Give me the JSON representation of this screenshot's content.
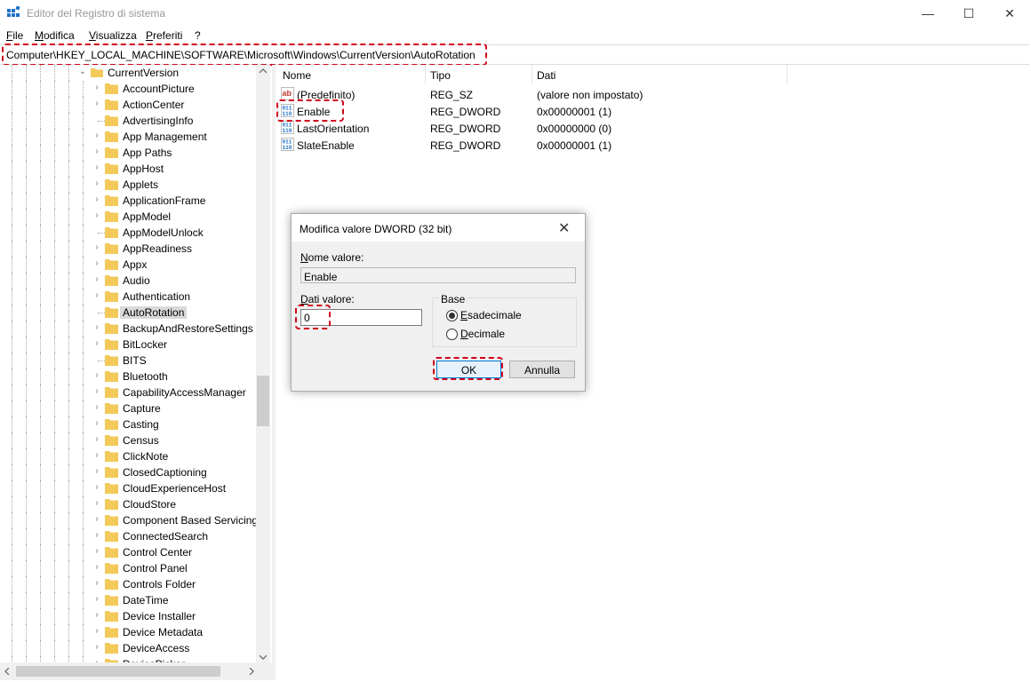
{
  "window": {
    "title": "Editor del Registro di sistema",
    "minimize_glyph": "—",
    "maximize_glyph": "☐",
    "close_glyph": "✕"
  },
  "menu": [
    "File",
    "Modifica",
    "Visualizza",
    "Preferiti",
    "?"
  ],
  "address": "Computer\\HKEY_LOCAL_MACHINE\\SOFTWARE\\Microsoft\\Windows\\CurrentVersion\\AutoRotation",
  "tree": {
    "parent": "CurrentVersion",
    "items": [
      {
        "label": "AccountPicture",
        "expandable": true
      },
      {
        "label": "ActionCenter",
        "expandable": true
      },
      {
        "label": "AdvertisingInfo",
        "expandable": false
      },
      {
        "label": "App Management",
        "expandable": true
      },
      {
        "label": "App Paths",
        "expandable": true
      },
      {
        "label": "AppHost",
        "expandable": true
      },
      {
        "label": "Applets",
        "expandable": true
      },
      {
        "label": "ApplicationFrame",
        "expandable": true
      },
      {
        "label": "AppModel",
        "expandable": true
      },
      {
        "label": "AppModelUnlock",
        "expandable": false
      },
      {
        "label": "AppReadiness",
        "expandable": true
      },
      {
        "label": "Appx",
        "expandable": true
      },
      {
        "label": "Audio",
        "expandable": true
      },
      {
        "label": "Authentication",
        "expandable": true
      },
      {
        "label": "AutoRotation",
        "expandable": false,
        "selected": true
      },
      {
        "label": "BackupAndRestoreSettings",
        "expandable": true
      },
      {
        "label": "BitLocker",
        "expandable": true
      },
      {
        "label": "BITS",
        "expandable": false
      },
      {
        "label": "Bluetooth",
        "expandable": true
      },
      {
        "label": "CapabilityAccessManager",
        "expandable": true
      },
      {
        "label": "Capture",
        "expandable": true
      },
      {
        "label": "Casting",
        "expandable": true
      },
      {
        "label": "Census",
        "expandable": true
      },
      {
        "label": "ClickNote",
        "expandable": true
      },
      {
        "label": "ClosedCaptioning",
        "expandable": true
      },
      {
        "label": "CloudExperienceHost",
        "expandable": true
      },
      {
        "label": "CloudStore",
        "expandable": true
      },
      {
        "label": "Component Based Servicing",
        "expandable": true
      },
      {
        "label": "ConnectedSearch",
        "expandable": true
      },
      {
        "label": "Control Center",
        "expandable": true
      },
      {
        "label": "Control Panel",
        "expandable": true
      },
      {
        "label": "Controls Folder",
        "expandable": true
      },
      {
        "label": "DateTime",
        "expandable": true
      },
      {
        "label": "Device Installer",
        "expandable": true
      },
      {
        "label": "Device Metadata",
        "expandable": true
      },
      {
        "label": "DeviceAccess",
        "expandable": true
      },
      {
        "label": "DevicePicker",
        "expandable": true
      }
    ]
  },
  "list": {
    "columns": [
      "Nome",
      "Tipo",
      "Dati"
    ],
    "rows": [
      {
        "name": "(Predefinito)",
        "type": "REG_SZ",
        "data": "(valore non impostato)",
        "icon": "string-value-icon"
      },
      {
        "name": "Enable",
        "type": "REG_DWORD",
        "data": "0x00000001 (1)",
        "icon": "dword-value-icon"
      },
      {
        "name": "LastOrientation",
        "type": "REG_DWORD",
        "data": "0x00000000 (0)",
        "icon": "dword-value-icon"
      },
      {
        "name": "SlateEnable",
        "type": "REG_DWORD",
        "data": "0x00000001 (1)",
        "icon": "dword-value-icon"
      }
    ]
  },
  "dialog": {
    "title": "Modifica valore DWORD (32 bit)",
    "close_glyph": "✕",
    "name_label": "Nome valore:",
    "name_value": "Enable",
    "data_label": "Dati valore:",
    "data_value": "0",
    "base_label": "Base",
    "radio_hex": "Esadecimale",
    "radio_dec": "Decimale",
    "selected_base": "Esadecimale",
    "ok": "OK",
    "cancel": "Annulla"
  },
  "colors": {
    "highlight": "#d0021b",
    "folder": "#f3c95a",
    "selection": "#d9d9d9",
    "accent": "#0078d7"
  }
}
